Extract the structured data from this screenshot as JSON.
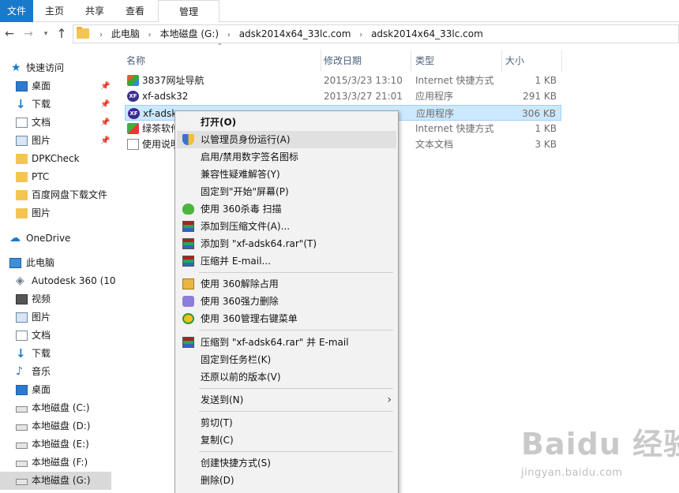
{
  "ribbon": {
    "tabs": [
      "文件",
      "主页",
      "共享",
      "查看",
      "管理"
    ]
  },
  "address": {
    "crumbs": [
      "此电脑",
      "本地磁盘 (G:)",
      "adsk2014x64_33lc.com",
      "adsk2014x64_33lc.com"
    ]
  },
  "nav": {
    "items": [
      {
        "label": "快速访问",
        "icon": "star-icon",
        "pinned": false
      },
      {
        "label": "桌面",
        "icon": "desktop-icon",
        "pinned": true
      },
      {
        "label": "下载",
        "icon": "download-icon",
        "pinned": true
      },
      {
        "label": "文档",
        "icon": "document-icon",
        "pinned": true
      },
      {
        "label": "图片",
        "icon": "pictures-icon",
        "pinned": true
      },
      {
        "label": "DPKCheck",
        "icon": "folder-icon",
        "pinned": false
      },
      {
        "label": "PTC",
        "icon": "folder-icon",
        "pinned": false
      },
      {
        "label": "百度网盘下载文件",
        "icon": "folder-icon",
        "pinned": false
      },
      {
        "label": "图片",
        "icon": "folder-icon",
        "pinned": false
      },
      {
        "label": "OneDrive",
        "icon": "onedrive-icon",
        "pinned": false
      },
      {
        "label": "此电脑",
        "icon": "computer-icon",
        "pinned": false
      },
      {
        "label": "Autodesk 360 (10",
        "icon": "autodesk-icon",
        "pinned": false
      },
      {
        "label": "视频",
        "icon": "video-icon",
        "pinned": false
      },
      {
        "label": "图片",
        "icon": "pictures-icon",
        "pinned": false
      },
      {
        "label": "文档",
        "icon": "document-icon",
        "pinned": false
      },
      {
        "label": "下载",
        "icon": "download-icon",
        "pinned": false
      },
      {
        "label": "音乐",
        "icon": "music-icon",
        "pinned": false
      },
      {
        "label": "桌面",
        "icon": "desktop-icon",
        "pinned": false
      },
      {
        "label": "本地磁盘 (C:)",
        "icon": "drive-icon",
        "pinned": false
      },
      {
        "label": "本地磁盘 (D:)",
        "icon": "drive-icon",
        "pinned": false
      },
      {
        "label": "本地磁盘 (E:)",
        "icon": "drive-icon",
        "pinned": false
      },
      {
        "label": "本地磁盘 (F:)",
        "icon": "drive-icon",
        "pinned": false
      },
      {
        "label": "本地磁盘 (G:)",
        "icon": "drive-icon",
        "pinned": false,
        "selected": true
      }
    ]
  },
  "columns": {
    "name": "名称",
    "date": "修改日期",
    "type": "类型",
    "size": "大小"
  },
  "files": [
    {
      "name": "3837网址导航",
      "date": "2015/3/23 13:10",
      "type": "Internet 快捷方式",
      "size": "1 KB",
      "icon": "web-shortcut-icon"
    },
    {
      "name": "xf-adsk32",
      "date": "2013/3/27 21:01",
      "type": "应用程序",
      "size": "291 KB",
      "icon": "app-icon"
    },
    {
      "name": "xf-adsk",
      "date": "",
      "type": "应用程序",
      "size": "306 KB",
      "icon": "app-icon",
      "selected": true
    },
    {
      "name": "绿茶软件",
      "date": "",
      "type": "Internet 快捷方式",
      "size": "1 KB",
      "icon": "web-shortcut-icon"
    },
    {
      "name": "使用说明",
      "date": "",
      "type": "文本文档",
      "size": "3 KB",
      "icon": "text-file-icon"
    }
  ],
  "menu": {
    "items": [
      {
        "label": "打开(O)",
        "bold": true
      },
      {
        "label": "以管理员身份运行(A)",
        "icon": "uac-shield-icon",
        "hover": true
      },
      {
        "label": "启用/禁用数字签名图标"
      },
      {
        "label": "兼容性疑难解答(Y)"
      },
      {
        "label": "固定到\"开始\"屏幕(P)"
      },
      {
        "label": "使用 360杀毒 扫描",
        "icon": "360-antivirus-icon"
      },
      {
        "label": "添加到压缩文件(A)...",
        "icon": "winrar-icon"
      },
      {
        "label": "添加到 \"xf-adsk64.rar\"(T)",
        "icon": "winrar-icon"
      },
      {
        "label": "压缩并 E-mail...",
        "icon": "winrar-icon"
      },
      {
        "label": "使用 360解除占用",
        "icon": "360-unlock-icon"
      },
      {
        "label": "使用 360强力删除",
        "icon": "360-delete-icon"
      },
      {
        "label": "使用 360管理右键菜单",
        "icon": "360-menu-manager-icon"
      },
      {
        "label": "压缩到 \"xf-adsk64.rar\" 并 E-mail",
        "icon": "winrar-icon"
      },
      {
        "label": "固定到任务栏(K)"
      },
      {
        "label": "还原以前的版本(V)"
      },
      {
        "label": "发送到(N)",
        "submenu": true
      },
      {
        "label": "剪切(T)"
      },
      {
        "label": "复制(C)"
      },
      {
        "label": "创建快捷方式(S)"
      },
      {
        "label": "删除(D)"
      }
    ]
  },
  "watermark": {
    "logo": "Baidu 经验",
    "url": "jingyan.baidu.com"
  }
}
